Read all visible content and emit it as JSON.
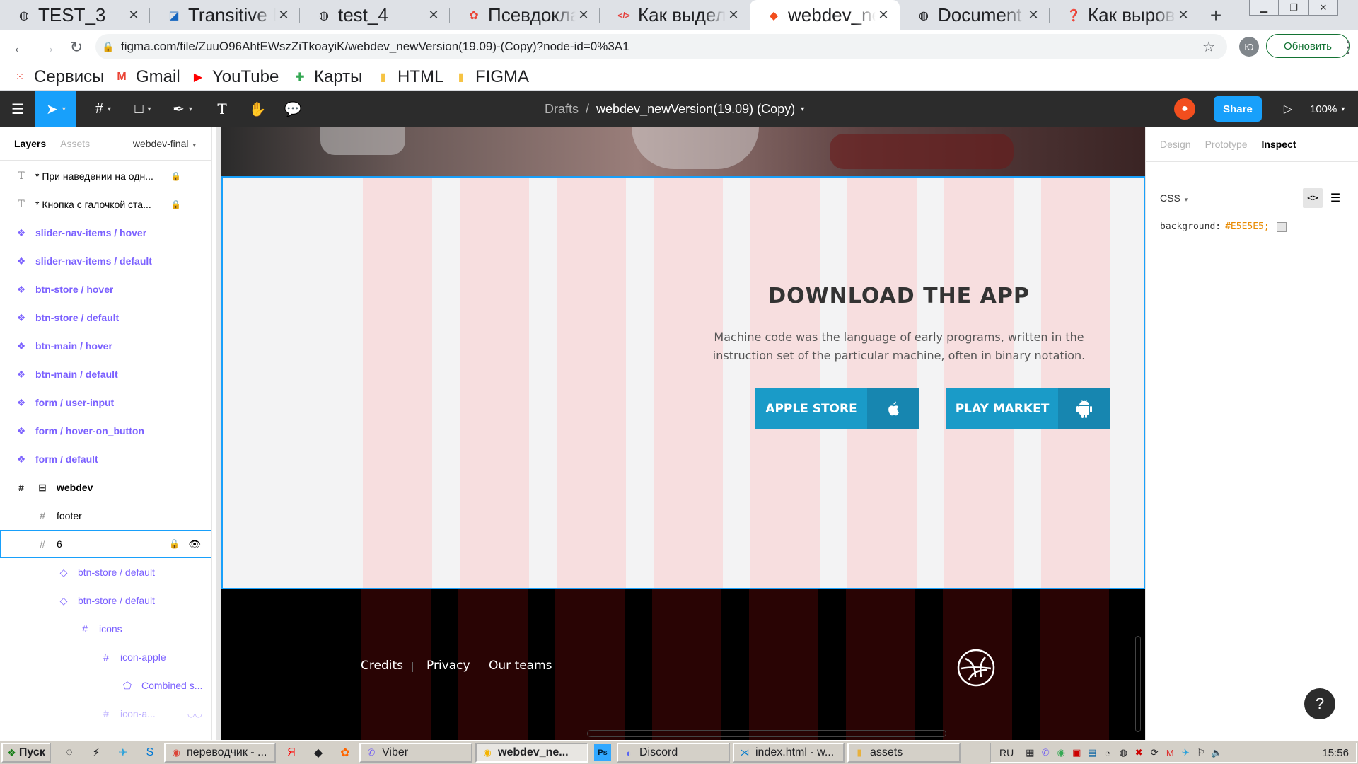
{
  "browser": {
    "tabs": [
      {
        "label": "TEST_3",
        "icon": "globe-icon",
        "color": "#5f6368"
      },
      {
        "label": "Transitive D",
        "icon": "app-icon",
        "color": "#1565c0"
      },
      {
        "label": "test_4",
        "icon": "globe-icon",
        "color": "#5f6368"
      },
      {
        "label": "Псевдоклас",
        "icon": "google-photos-icon",
        "color": "#ea4335"
      },
      {
        "label": "Как выдели",
        "icon": "code-icon",
        "color": "#e53935"
      },
      {
        "label": "webdev_nev",
        "icon": "figma-icon",
        "color": "#f24e1e"
      },
      {
        "label": "Document",
        "icon": "globe-icon",
        "color": "#5f6368"
      },
      {
        "label": "Как выровн",
        "icon": "question-icon",
        "color": "#f5a623"
      }
    ],
    "active_tab": 5,
    "new_tab_label": "+",
    "url": "figma.com/file/ZuuO96AhtEWszZiTkoayiK/webdev_newVersion(19.09)-(Copy)?node-id=0%3A1",
    "profile_initial": "Ю",
    "update_label": "Обновить",
    "bookmarks": [
      {
        "label": "Сервисы",
        "icon": "apps-grid-icon"
      },
      {
        "label": "Gmail",
        "icon": "gmail-icon"
      },
      {
        "label": "YouTube",
        "icon": "youtube-icon"
      },
      {
        "label": "Карты",
        "icon": "maps-icon"
      },
      {
        "label": "HTML",
        "icon": "folder-icon"
      },
      {
        "label": "FIGMA",
        "icon": "folder-icon"
      }
    ]
  },
  "figma": {
    "breadcrumb_root": "Drafts",
    "file_name": "webdev_newVersion(19.09) (Copy)",
    "share_label": "Share",
    "zoom": "100%",
    "left_tabs": {
      "layers": "Layers",
      "assets": "Assets",
      "page": "webdev-final"
    },
    "layers": [
      {
        "name": "* При наведении на одн...",
        "kind": "text",
        "locked": true
      },
      {
        "name": "* Кнопка с галочкой ста...",
        "kind": "text",
        "locked": true
      },
      {
        "name": "slider-nav-items / hover",
        "kind": "comp"
      },
      {
        "name": "slider-nav-items / default",
        "kind": "comp"
      },
      {
        "name": "btn-store / hover",
        "kind": "comp"
      },
      {
        "name": "btn-store / default",
        "kind": "comp"
      },
      {
        "name": "btn-main / hover",
        "kind": "comp"
      },
      {
        "name": "btn-main / default",
        "kind": "comp"
      },
      {
        "name": "form / user-input",
        "kind": "comp"
      },
      {
        "name": "form / hover-on_button",
        "kind": "comp"
      },
      {
        "name": "form / default",
        "kind": "comp"
      },
      {
        "name": "webdev",
        "kind": "frame-top"
      },
      {
        "name": "footer",
        "kind": "frame"
      },
      {
        "name": "6",
        "kind": "frame-selected"
      },
      {
        "name": "btn-store / default",
        "kind": "instance"
      },
      {
        "name": "btn-store / default",
        "kind": "instance"
      },
      {
        "name": "icons",
        "kind": "frame-inner"
      },
      {
        "name": "icon-apple",
        "kind": "frame-inner"
      },
      {
        "name": "Combined s...",
        "kind": "shape"
      },
      {
        "name": "icon-a...",
        "kind": "hidden"
      }
    ],
    "right_tabs": {
      "design": "Design",
      "prototype": "Prototype",
      "inspect": "Inspect"
    },
    "inspect_lang": "CSS",
    "css_property": "background:",
    "css_value": "#E5E5E5;",
    "help_label": "?"
  },
  "canvas": {
    "download_title": "DOWNLOAD THE APP",
    "download_text": "Machine code was the language of early programs, written in the instruction set of the particular machine, often in binary notation.",
    "apple_label": "APPLE STORE",
    "play_label": "PLAY MARKET",
    "footer_links": [
      "Credits",
      "Privacy",
      "Our teams"
    ],
    "accent_color": "#1a9bc8"
  },
  "taskbar": {
    "start_label": "Пуск",
    "buttons": [
      {
        "label": "переводчик - ...",
        "icon": "chrome-icon"
      },
      {
        "label": "Viber",
        "icon": "viber-icon"
      },
      {
        "label": "webdev_ne...",
        "icon": "chrome-icon"
      },
      {
        "label": "Discord",
        "icon": "discord-icon"
      },
      {
        "label": "index.html - w...",
        "icon": "vscode-icon"
      },
      {
        "label": "assets",
        "icon": "folder-icon"
      }
    ],
    "lang": "RU",
    "time": "15:56"
  }
}
